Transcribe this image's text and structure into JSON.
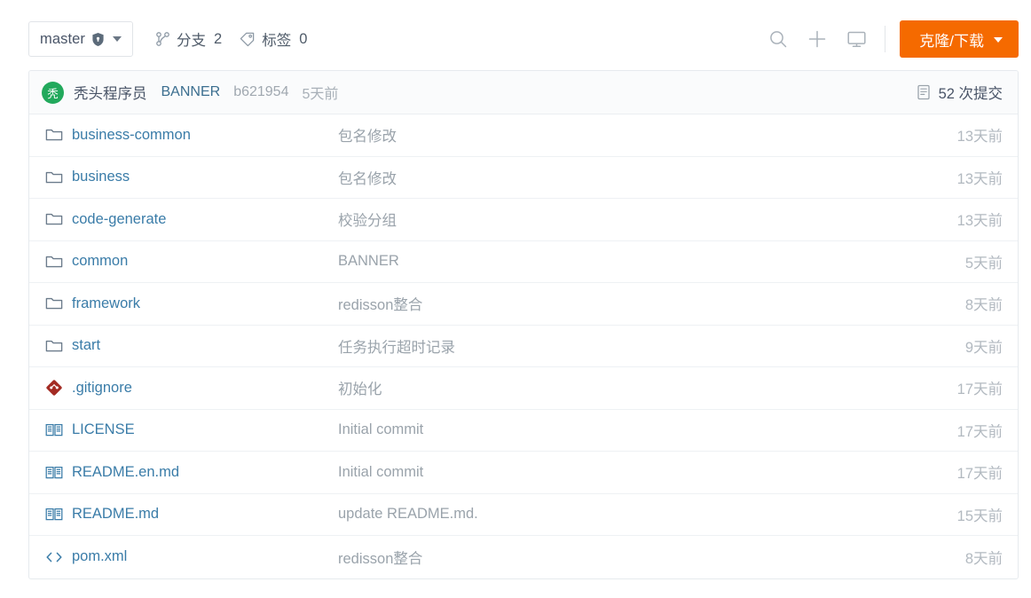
{
  "toolbar": {
    "branch_name": "master",
    "branch_icon": "shield-icon",
    "branches_label": "分支",
    "branches_count": "2",
    "tags_label": "标签",
    "tags_count": "0",
    "search_icon": "search-icon",
    "add_icon": "plus-icon",
    "desktop_icon": "monitor-icon",
    "clone_label": "克隆/下载",
    "accent_color": "#f56a00"
  },
  "commit_bar": {
    "avatar_initial": "秃",
    "avatar_color": "#22a95c",
    "author": "秃头程序员",
    "message": "BANNER",
    "hash": "b621954",
    "date": "5天前",
    "commit_count_icon": "commit-list-icon",
    "commit_count_label": "52 次提交"
  },
  "file_table": {
    "rows": [
      {
        "icon": "folder-icon",
        "name": "business-common",
        "message": "包名修改",
        "time": "13天前"
      },
      {
        "icon": "folder-icon",
        "name": "business",
        "message": "包名修改",
        "time": "13天前"
      },
      {
        "icon": "folder-icon",
        "name": "code-generate",
        "message": "校验分组",
        "time": "13天前"
      },
      {
        "icon": "folder-icon",
        "name": "common",
        "message": "BANNER",
        "time": "5天前"
      },
      {
        "icon": "folder-icon",
        "name": "framework",
        "message": "redisson整合",
        "time": "8天前"
      },
      {
        "icon": "folder-icon",
        "name": "start",
        "message": "任务执行超时记录",
        "time": "9天前"
      },
      {
        "icon": "git-icon",
        "name": ".gitignore",
        "message": "初始化",
        "time": "17天前"
      },
      {
        "icon": "book-icon",
        "name": "LICENSE",
        "message": "Initial commit",
        "time": "17天前"
      },
      {
        "icon": "book-icon",
        "name": "README.en.md",
        "message": "Initial commit",
        "time": "17天前"
      },
      {
        "icon": "book-icon",
        "name": "README.md",
        "message": "update README.md.",
        "time": "15天前"
      },
      {
        "icon": "code-icon",
        "name": "pom.xml",
        "message": "redisson整合",
        "time": "8天前"
      }
    ]
  }
}
